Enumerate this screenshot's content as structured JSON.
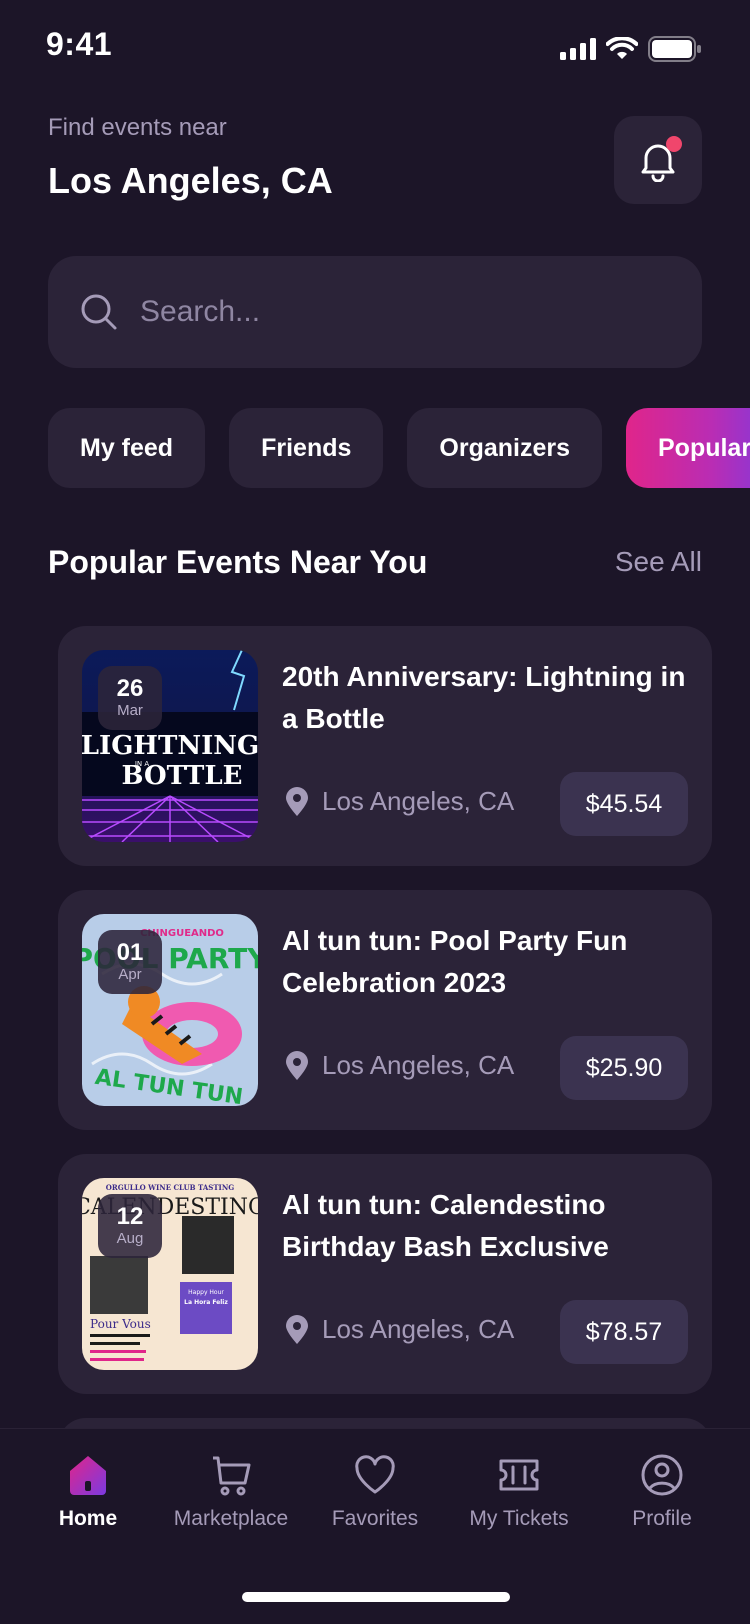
{
  "status_bar": {
    "time": "9:41"
  },
  "header": {
    "location_label": "Find events near",
    "location": "Los Angeles, CA"
  },
  "search": {
    "placeholder": "Search..."
  },
  "filters": [
    {
      "label": "My feed",
      "active": false
    },
    {
      "label": "Friends",
      "active": false
    },
    {
      "label": "Organizers",
      "active": false
    },
    {
      "label": "Popular",
      "active": true
    }
  ],
  "section": {
    "title": "Popular Events Near You",
    "see_all": "See All"
  },
  "events": [
    {
      "day": "26",
      "month": "Mar",
      "title": "20th Anniversary: Lightning in a Bottle",
      "location": "Los Angeles, CA",
      "price": "$45.54",
      "poster_text": [
        "LIGHTNING",
        "IN A",
        "BOTTLE"
      ]
    },
    {
      "day": "01",
      "month": "Apr",
      "title": "Al tun tun: Pool Party Fun Celebration 2023",
      "location": "Los Angeles, CA",
      "price": "$25.90",
      "poster_text": [
        "CHINGUEANDO",
        "POOL PARTY",
        "AL TUN TUN"
      ]
    },
    {
      "day": "12",
      "month": "Aug",
      "title": "Al tun tun: Calendestino Birthday Bash Exclusive",
      "location": "Los Angeles, CA",
      "price": "$78.57",
      "poster_text": [
        "ORGULLO WINE CLUB TASTING",
        "CALENDESTINO",
        "Pour Vous",
        "Happy Hour",
        "La Hora Feliz"
      ]
    }
  ],
  "nav": [
    {
      "label": "Home",
      "icon": "home-icon",
      "active": true
    },
    {
      "label": "Marketplace",
      "icon": "cart-icon",
      "active": false
    },
    {
      "label": "Favorites",
      "icon": "heart-icon",
      "active": false
    },
    {
      "label": "My Tickets",
      "icon": "ticket-icon",
      "active": false
    },
    {
      "label": "Profile",
      "icon": "profile-icon",
      "active": false
    }
  ],
  "colors": {
    "background": "#1c1528",
    "surface": "#2b2338",
    "accent_start": "#e0258a",
    "accent_end": "#7c3ae0",
    "notification_dot": "#f0466c"
  }
}
